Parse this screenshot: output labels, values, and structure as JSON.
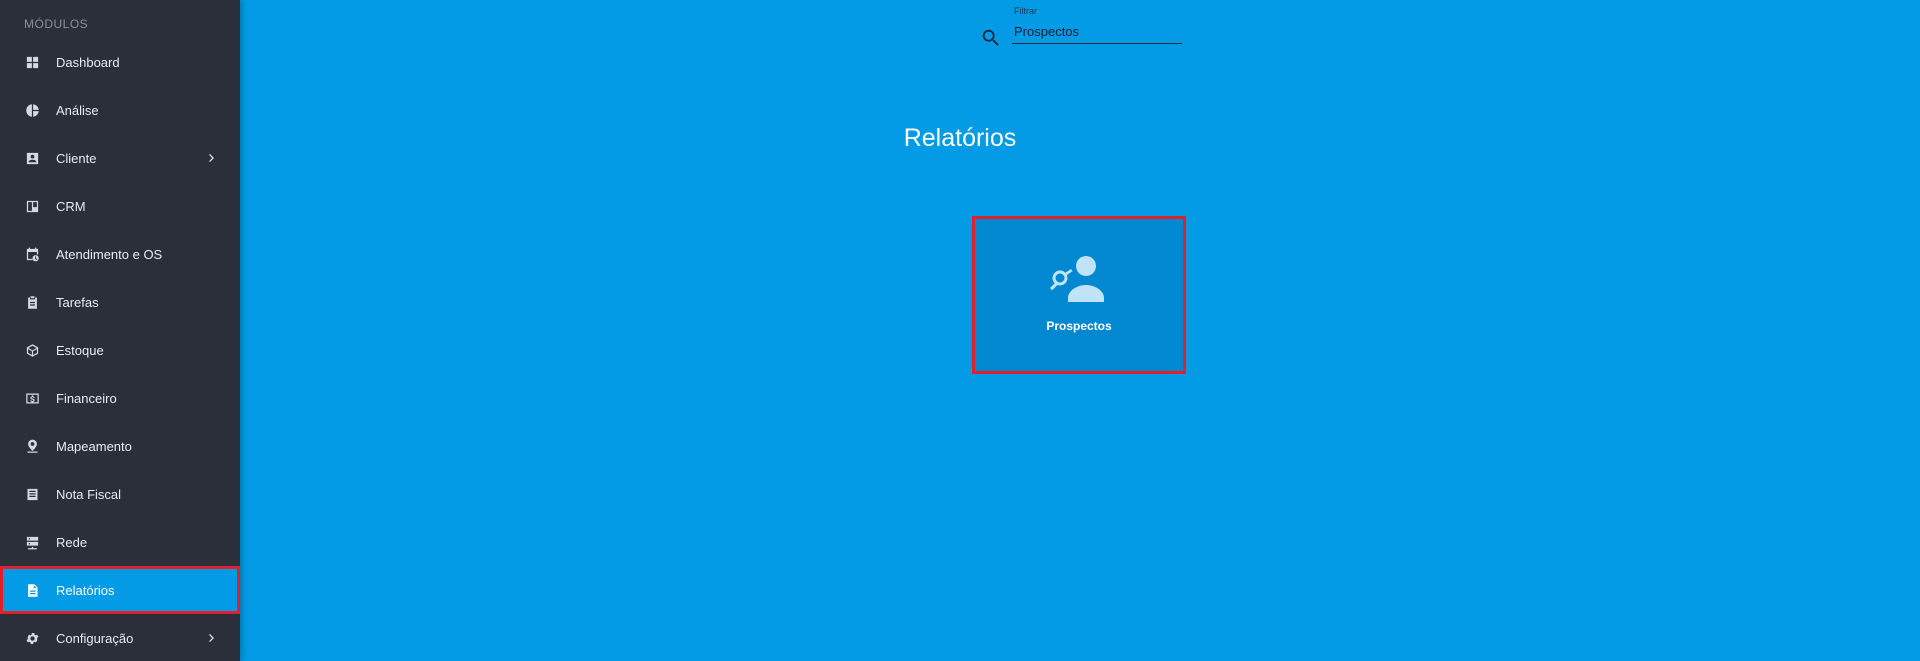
{
  "sidebar": {
    "section_title": "MÓDULOS",
    "items": [
      {
        "label": "Dashboard",
        "icon": "dashboard-icon"
      },
      {
        "label": "Análise",
        "icon": "pie-chart-icon"
      },
      {
        "label": "Cliente",
        "icon": "contact-card-icon",
        "has_submenu": true
      },
      {
        "label": "CRM",
        "icon": "trello-board-icon"
      },
      {
        "label": "Atendimento e OS",
        "icon": "calendar-clock-icon"
      },
      {
        "label": "Tarefas",
        "icon": "clipboard-icon"
      },
      {
        "label": "Estoque",
        "icon": "package-icon"
      },
      {
        "label": "Financeiro",
        "icon": "money-icon"
      },
      {
        "label": "Mapeamento",
        "icon": "map-pin-icon"
      },
      {
        "label": "Nota Fiscal",
        "icon": "receipt-icon"
      },
      {
        "label": "Rede",
        "icon": "server-icon"
      },
      {
        "label": "Relatórios",
        "icon": "document-icon",
        "active": true
      },
      {
        "label": "Configuração",
        "icon": "gear-icon",
        "has_submenu": true
      }
    ]
  },
  "filter": {
    "label": "Filtrar",
    "value": "Prospectos"
  },
  "main": {
    "title": "Relatórios",
    "cards": [
      {
        "label": "Prospectos",
        "icon": "prospect-search-user-icon"
      }
    ]
  },
  "colors": {
    "sidebar_bg": "#2b2f3a",
    "main_bg": "#039be5",
    "card_bg": "#0288d1",
    "highlight": "#e2202c"
  }
}
